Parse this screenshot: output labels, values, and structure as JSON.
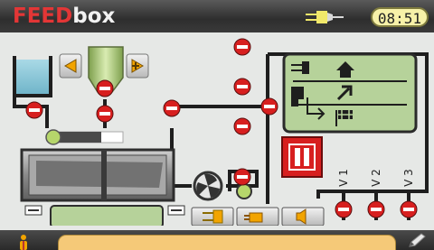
{
  "header": {
    "logo_feed": "FEED",
    "logo_box": "box",
    "time": "08:51"
  },
  "valves": {
    "labels": [
      "V 1",
      "V 2",
      "V 3"
    ]
  },
  "colors": {
    "alarm_red": "#d71f1f",
    "ok_green": "#b6d66b",
    "lcd_green": "#b6d29a",
    "bar_bg": "#333333",
    "status_bar": "#f5c978"
  },
  "icons": {
    "status_plug": "plug-icon",
    "pause": "pause-icon",
    "home": "home-icon",
    "operator": "person-icon",
    "edit": "pencil-icon"
  }
}
